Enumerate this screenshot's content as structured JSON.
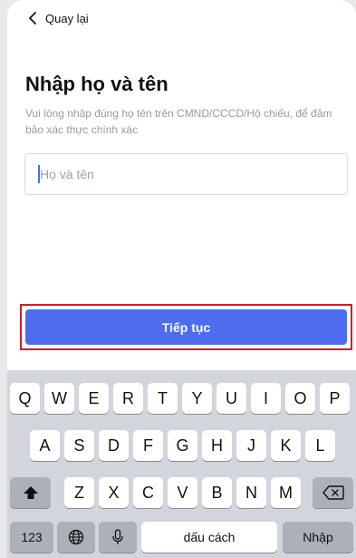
{
  "header": {
    "back_label": "Quay lại"
  },
  "form": {
    "title": "Nhập họ và tên",
    "subtitle": "Vui lòng nhập đúng họ tên trên CMND/CCCD/Hộ chiếu, để đảm bảo xác thực chính xác",
    "name_input": {
      "placeholder": "Họ và tên",
      "value": ""
    },
    "continue_label": "Tiếp tục"
  },
  "keyboard": {
    "row1": [
      "Q",
      "W",
      "E",
      "R",
      "T",
      "Y",
      "U",
      "I",
      "O",
      "P"
    ],
    "row2": [
      "A",
      "S",
      "D",
      "F",
      "G",
      "H",
      "J",
      "K",
      "L"
    ],
    "row3": [
      "Z",
      "X",
      "C",
      "V",
      "B",
      "N",
      "M"
    ],
    "numbers_label": "123",
    "space_label": "dấu cách",
    "return_label": "Nhập",
    "icons": {
      "shift": "shift-icon",
      "backspace": "backspace-icon",
      "globe": "globe-icon",
      "mic": "microphone-icon"
    }
  },
  "colors": {
    "accent": "#4d6cf0",
    "highlight_border": "#d6182c",
    "keyboard_bg": "#d2d5db"
  }
}
